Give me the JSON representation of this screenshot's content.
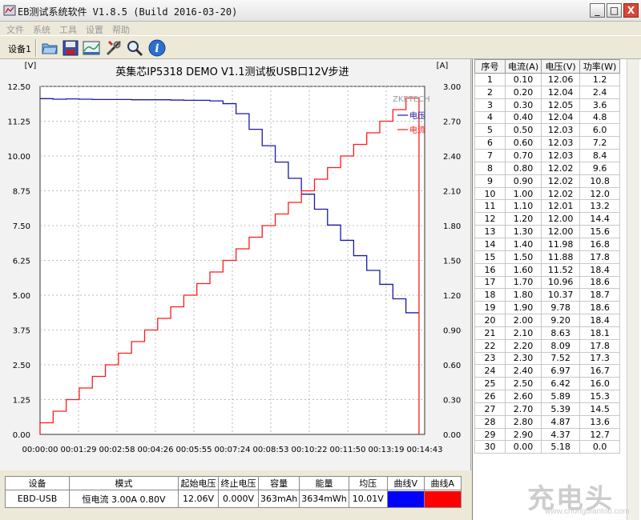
{
  "window": {
    "title": "EB测试系统软件  V1.8.5 (Build 2016-03-20)",
    "buttons": {
      "minimize": "_",
      "maximize": "□",
      "close": "X"
    }
  },
  "menu": [
    "文件",
    "系统",
    "工具",
    "设置",
    "帮助"
  ],
  "toolbar": {
    "device_label": "设备1",
    "icons": [
      "open-folder-icon",
      "save-icon",
      "chart-view-icon",
      "tools-icon",
      "search-icon",
      "info-icon"
    ]
  },
  "chart_data": {
    "type": "line",
    "title": "英集芯IP5318 DEMO V1.1测试板USB口12V步进",
    "left_unit": "[V]",
    "right_unit": "[A]",
    "brand": "ZKETECH",
    "legend": [
      {
        "name": "电压",
        "color": "#1a1aa8"
      },
      {
        "name": "电流",
        "color": "#ff1a1a"
      }
    ],
    "x_ticks": [
      "00:00:00",
      "00:01:29",
      "00:02:58",
      "00:04:26",
      "00:05:55",
      "00:07:24",
      "00:08:53",
      "00:10:22",
      "00:11:50",
      "00:13:19",
      "00:14:43"
    ],
    "y_left_ticks": [
      "12.50",
      "11.25",
      "10.00",
      "8.75",
      "7.50",
      "6.25",
      "5.00",
      "3.75",
      "2.50",
      "1.25",
      "0.00"
    ],
    "y_right_ticks": [
      "3.00",
      "2.70",
      "2.40",
      "2.10",
      "1.80",
      "1.50",
      "1.20",
      "0.90",
      "0.60",
      "0.30",
      "0.00"
    ],
    "ylim_left": [
      0,
      12.5
    ],
    "ylim_right": [
      0,
      3.0
    ],
    "xlim_seconds": [
      0,
      883
    ],
    "step_seconds": 30,
    "grid": true,
    "legend_position": "top-right"
  },
  "table": {
    "headers": [
      "序号",
      "电流(A)",
      "电压(V)",
      "功率(W)"
    ],
    "rows": [
      [
        "1",
        "0.10",
        "12.06",
        "1.2"
      ],
      [
        "2",
        "0.20",
        "12.04",
        "2.4"
      ],
      [
        "3",
        "0.30",
        "12.05",
        "3.6"
      ],
      [
        "4",
        "0.40",
        "12.04",
        "4.8"
      ],
      [
        "5",
        "0.50",
        "12.03",
        "6.0"
      ],
      [
        "6",
        "0.60",
        "12.03",
        "7.2"
      ],
      [
        "7",
        "0.70",
        "12.03",
        "8.4"
      ],
      [
        "8",
        "0.80",
        "12.02",
        "9.6"
      ],
      [
        "9",
        "0.90",
        "12.02",
        "10.8"
      ],
      [
        "10",
        "1.00",
        "12.02",
        "12.0"
      ],
      [
        "11",
        "1.10",
        "12.01",
        "13.2"
      ],
      [
        "12",
        "1.20",
        "12.00",
        "14.4"
      ],
      [
        "13",
        "1.30",
        "12.00",
        "15.6"
      ],
      [
        "14",
        "1.40",
        "11.98",
        "16.8"
      ],
      [
        "15",
        "1.50",
        "11.88",
        "17.8"
      ],
      [
        "16",
        "1.60",
        "11.52",
        "18.4"
      ],
      [
        "17",
        "1.70",
        "10.96",
        "18.6"
      ],
      [
        "18",
        "1.80",
        "10.37",
        "18.7"
      ],
      [
        "19",
        "1.90",
        "9.78",
        "18.6"
      ],
      [
        "20",
        "2.00",
        "9.20",
        "18.4"
      ],
      [
        "21",
        "2.10",
        "8.63",
        "18.1"
      ],
      [
        "22",
        "2.20",
        "8.09",
        "17.8"
      ],
      [
        "23",
        "2.30",
        "7.52",
        "17.3"
      ],
      [
        "24",
        "2.40",
        "6.97",
        "16.7"
      ],
      [
        "25",
        "2.50",
        "6.42",
        "16.0"
      ],
      [
        "26",
        "2.60",
        "5.89",
        "15.3"
      ],
      [
        "27",
        "2.70",
        "5.39",
        "14.5"
      ],
      [
        "28",
        "2.80",
        "4.87",
        "13.6"
      ],
      [
        "29",
        "2.90",
        "4.37",
        "12.7"
      ],
      [
        "30",
        "0.00",
        "5.18",
        "0.0"
      ]
    ]
  },
  "summary": {
    "headers": [
      "设备",
      "模式",
      "起始电压",
      "终止电压",
      "容量",
      "能量",
      "均压",
      "曲线V",
      "曲线A"
    ],
    "values": [
      "EBD-USB",
      "恒电流  3.00A  0.80V",
      "12.06V",
      "0.000V",
      "363mAh",
      "3634mWh",
      "10.01V"
    ],
    "curve_v_color": "#0000ff",
    "curve_a_color": "#ff0000"
  },
  "watermark": {
    "big": "充电头",
    "small": "www.chongdiantou.com"
  }
}
